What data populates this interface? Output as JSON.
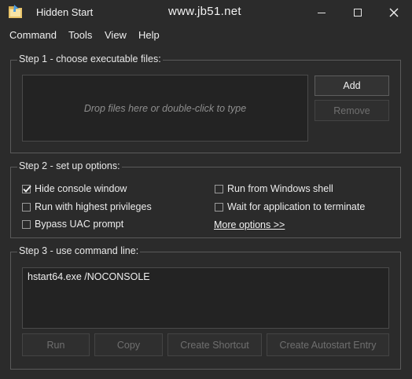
{
  "window": {
    "title": "Hidden Start",
    "watermark": "www.jb51.net",
    "controls": {
      "minimize_icon": "minimize-icon",
      "maximize_icon": "maximize-icon",
      "close_icon": "close-icon"
    }
  },
  "menu": [
    "Command",
    "Tools",
    "View",
    "Help"
  ],
  "step1": {
    "title": "Step 1 - choose executable files:",
    "drop_hint": "Drop files here or double-click to type",
    "add_label": "Add",
    "remove_label": "Remove"
  },
  "step2": {
    "title": "Step 2 - set up options:",
    "options": [
      {
        "label": "Hide console window",
        "checked": true
      },
      {
        "label": "Run with highest privileges",
        "checked": false
      },
      {
        "label": "Bypass UAC prompt",
        "checked": false
      },
      {
        "label": "Run from Windows shell",
        "checked": false
      },
      {
        "label": "Wait for application to terminate",
        "checked": false
      }
    ],
    "more_options": "More options >>"
  },
  "step3": {
    "title": "Step 3 - use command line:",
    "command": "hstart64.exe /NOCONSOLE",
    "buttons": [
      "Run",
      "Copy",
      "Create Shortcut",
      "Create Autostart Entry"
    ]
  },
  "colors": {
    "background": "#2b2b2b",
    "border": "#5a5a5a",
    "disabled_text": "#6f6f6f"
  }
}
